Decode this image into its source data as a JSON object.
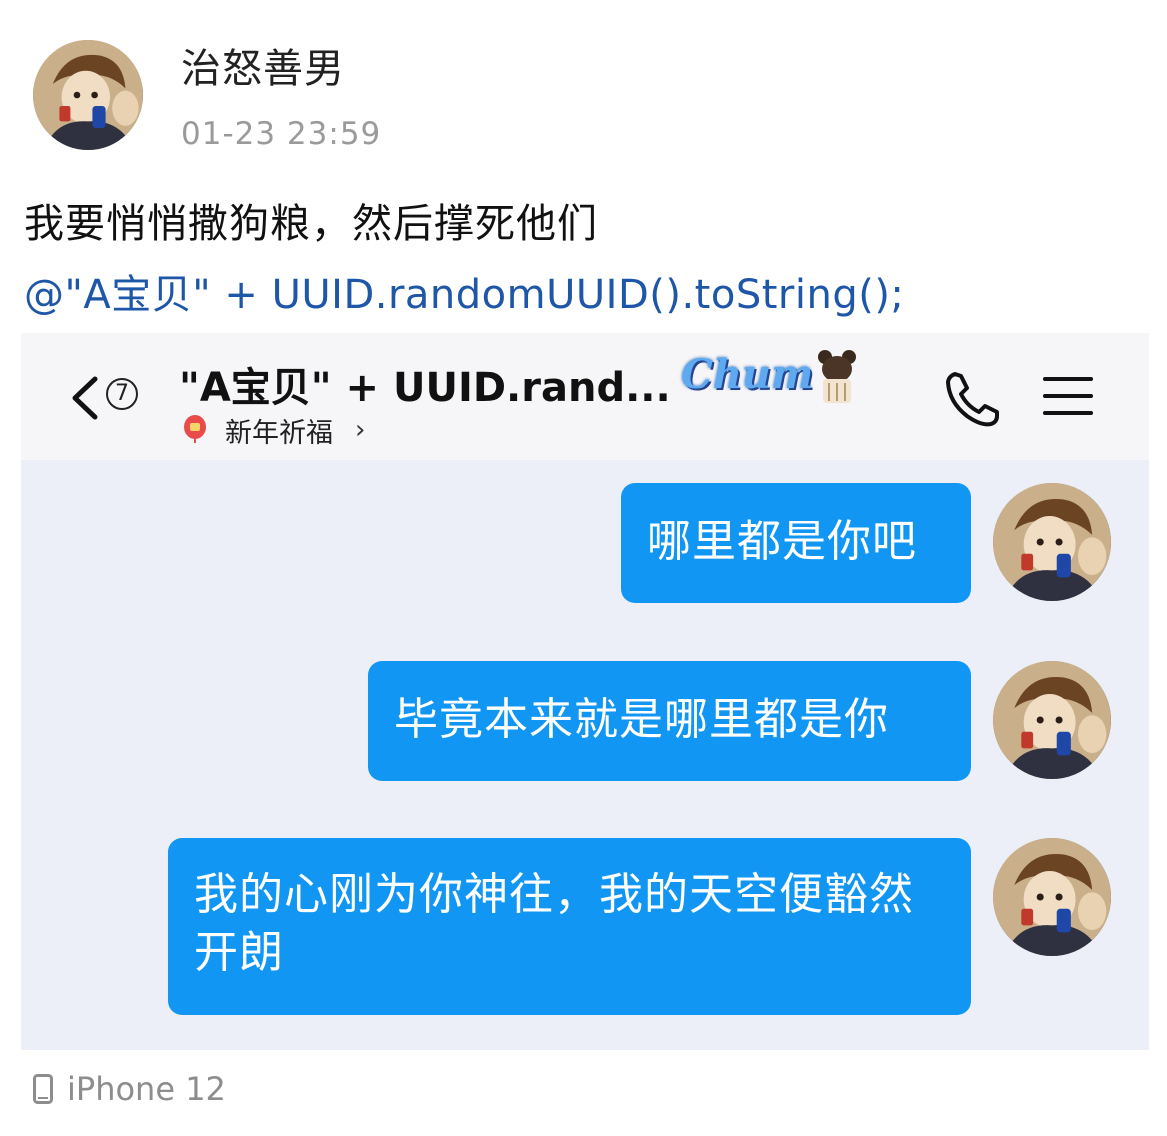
{
  "post": {
    "author_name": "治怒善男",
    "timestamp": "01-23 23:59",
    "text": "我要悄悄撒狗粮，然后撑死他们",
    "code_line": "@\"A宝贝\" + UUID.randomUUID().toString();",
    "device": "iPhone 12"
  },
  "chat": {
    "header": {
      "title": "\"A宝贝\" + UUID.rand...",
      "unread_count": "7",
      "logo_text": "Chum",
      "subtitle": "新年祈福",
      "subtitle_chevron": "›"
    },
    "messages": [
      {
        "text": "哪里都是你吧"
      },
      {
        "text": "毕竟本来就是哪里都是你"
      },
      {
        "text": "我的心刚为你神往，我的天空便豁然开朗"
      }
    ]
  },
  "icons": {
    "back": "chevron-left-icon",
    "phone": "phone-icon",
    "menu": "hamburger-menu-icon",
    "device": "phone-device-icon",
    "new_year": "lantern-icon"
  },
  "colors": {
    "bubble": "#1296f4",
    "code_text": "#1e56a8",
    "chat_background": "#eceff8",
    "header_background": "#f6f6f8"
  }
}
